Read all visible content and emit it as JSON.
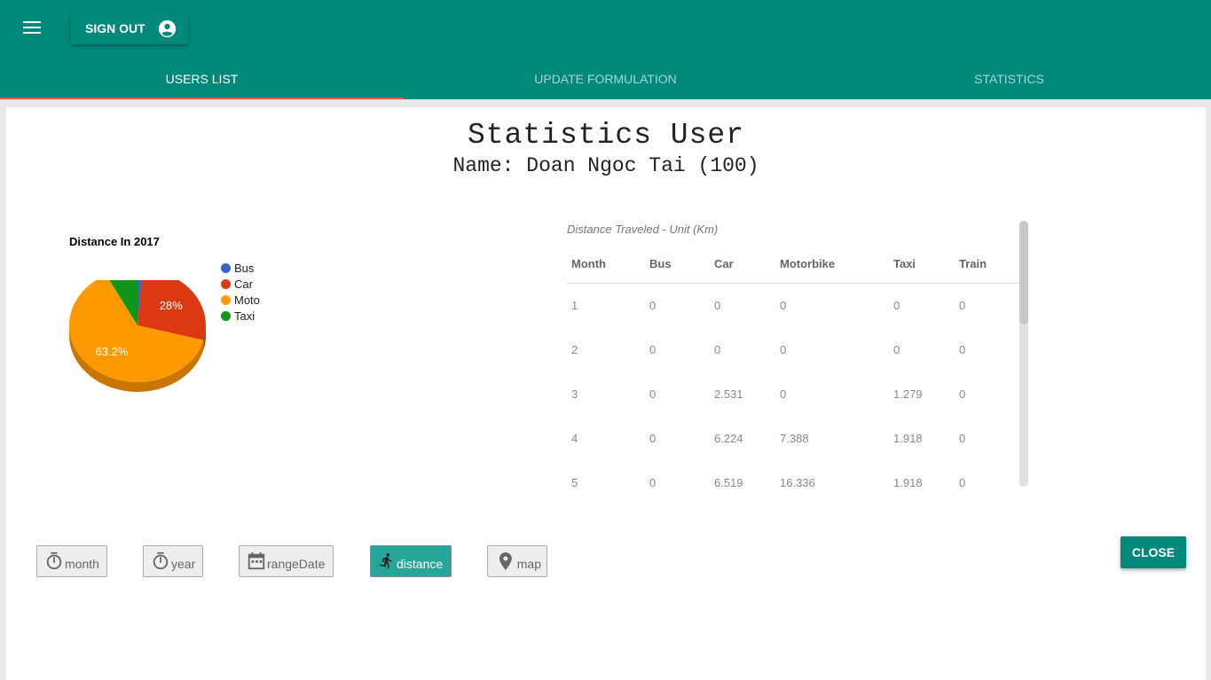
{
  "header": {
    "menu_icon": "hamburger-menu-icon",
    "signout_label": "SIGN OUT",
    "account_icon": "account-circle-icon",
    "tabs": [
      {
        "label": "USERS LIST",
        "active": true
      },
      {
        "label": "UPDATE FORMULATION",
        "active": false
      },
      {
        "label": "STATISTICS",
        "active": false
      }
    ],
    "colors": {
      "primary": "#00897b",
      "tab_indicator": "#ef5350"
    }
  },
  "dialog": {
    "title": "Statistics User",
    "subtitle": "Name: Doan Ngoc Tai (100)",
    "close_label": "CLOSE"
  },
  "chart_data": {
    "type": "pie",
    "title": "Distance In 2017",
    "legend_position": "right",
    "categories": [
      "Bus",
      "Car",
      "Moto",
      "Taxi"
    ],
    "values": [
      1.2,
      28.0,
      63.2,
      7.6
    ],
    "labels": [
      "",
      "28%",
      "63.2%",
      ""
    ],
    "colors": [
      "#3366cc",
      "#dc3912",
      "#ff9900",
      "#109618"
    ]
  },
  "table": {
    "caption": "Distance Traveled - Unit (Km)",
    "headers": [
      "Month",
      "Bus",
      "Car",
      "Motorbike",
      "Taxi",
      "Train"
    ],
    "rows": [
      [
        "1",
        "0",
        "0",
        "0",
        "0",
        "0"
      ],
      [
        "2",
        "0",
        "0",
        "0",
        "0",
        "0"
      ],
      [
        "3",
        "0",
        "2.531",
        "0",
        "1.279",
        "0"
      ],
      [
        "4",
        "0",
        "6.224",
        "7.388",
        "1.918",
        "0"
      ],
      [
        "5",
        "0",
        "6.519",
        "16.336",
        "1.918",
        "0"
      ]
    ]
  },
  "filters": [
    {
      "label": "month",
      "icon": "timer-icon",
      "active": false
    },
    {
      "label": "year",
      "icon": "timer-icon",
      "active": false
    },
    {
      "label": "rangeDate",
      "icon": "calendar-icon",
      "active": false
    },
    {
      "label": "distance",
      "icon": "walk-icon",
      "active": true
    },
    {
      "label": "map",
      "icon": "map-pin-icon",
      "active": false
    }
  ]
}
